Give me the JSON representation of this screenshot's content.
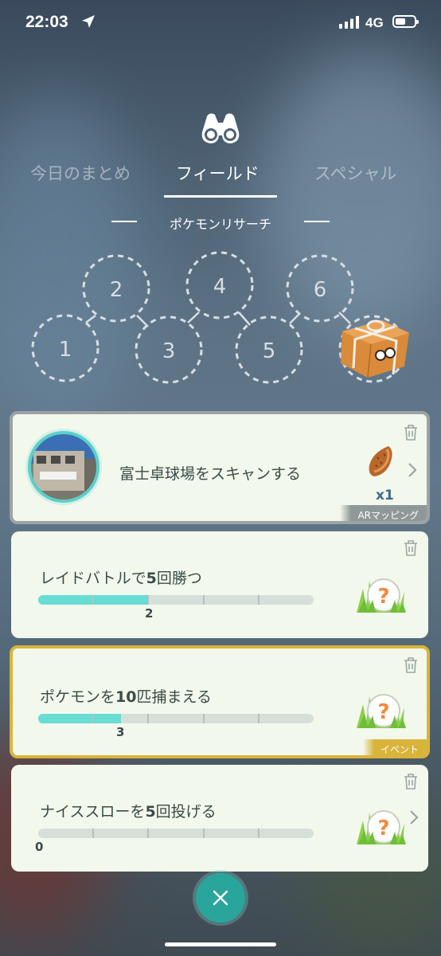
{
  "status_bar": {
    "time": "22:03",
    "network": "4G",
    "battery_level": 0.55
  },
  "tabs": {
    "today": "今日のまとめ",
    "field": "フィールド",
    "special": "スペシャル",
    "active": "field"
  },
  "section_title": "ポケモンリサーチ",
  "research_steps": [
    "1",
    "2",
    "3",
    "4",
    "5",
    "6"
  ],
  "tasks": [
    {
      "title": "富士卓球場をスキャンする",
      "reward_item": "pinap-berry-icon",
      "reward_count": "x1",
      "tag": "ARマッピング"
    },
    {
      "title_pre": "レイドバトルで",
      "title_num": "5",
      "title_post": "回勝つ",
      "progress": 2,
      "goal": 5,
      "count": "2"
    },
    {
      "title_pre": "ポケモンを",
      "title_num": "10",
      "title_post": "匹捕まえる",
      "progress": 3,
      "goal": 10,
      "count": "3",
      "tag": "イベント"
    },
    {
      "title_pre": "ナイススローを",
      "title_num": "5",
      "title_post": "回投げる",
      "progress": 0,
      "goal": 5,
      "count": "0"
    }
  ],
  "colors": {
    "progress": "#69dcd4",
    "event_border": "#d9b43a",
    "close_button": "#2aa59b"
  }
}
